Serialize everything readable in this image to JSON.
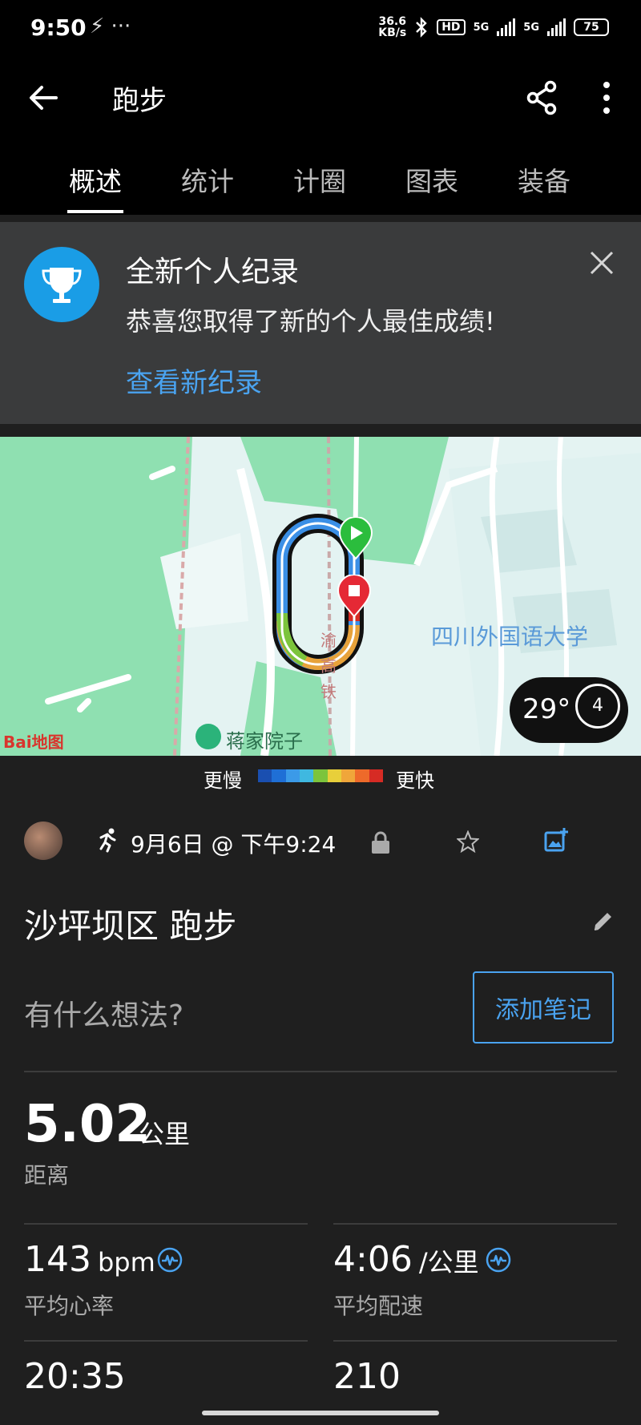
{
  "status_bar": {
    "time": "9:50",
    "misc": "⚡ ···",
    "net_speed_top": "36.6",
    "net_speed_bottom": "KB/s",
    "hd_label": "HD",
    "sig1_label": "5G",
    "sig2_label": "5G",
    "battery": "75"
  },
  "app_bar": {
    "title": "跑步",
    "back_icon": "arrow-left-icon",
    "share_icon": "share-icon",
    "more_icon": "more-vertical-icon"
  },
  "tabs": [
    {
      "label": "概述",
      "active": true
    },
    {
      "label": "统计",
      "active": false
    },
    {
      "label": "计圈",
      "active": false
    },
    {
      "label": "图表",
      "active": false
    },
    {
      "label": "装备",
      "active": false
    }
  ],
  "record_banner": {
    "title": "全新个人纪录",
    "subtitle": "恭喜您取得了新的个人最佳成绩!",
    "link": "查看新纪录",
    "icon": "trophy-icon"
  },
  "map": {
    "university_label": "四川外国语大学",
    "rail_label_chars": [
      "渝",
      "高",
      "铁"
    ],
    "poi_label": "蒋家院子",
    "provider": "Bai地图",
    "temperature": "29°",
    "wind_level": "4"
  },
  "pace_legend": {
    "slow": "更慢",
    "fast": "更快",
    "colors": [
      "#1a4fb0",
      "#1f6fd6",
      "#3b9ae8",
      "#3fb8e0",
      "#7cc43c",
      "#e8cf3a",
      "#f0a63a",
      "#ee6a2a",
      "#d62b24"
    ]
  },
  "activity": {
    "date": "9月6日 @ 下午9:24",
    "title": "沙坪坝区 跑步",
    "thought_placeholder": "有什么想法?",
    "add_note": "添加笔记"
  },
  "stats": {
    "distance_value": "5.02",
    "distance_unit": "公里",
    "distance_label": "距离",
    "hr_value": "143",
    "hr_unit": "bpm",
    "hr_label": "平均心率",
    "pace_value": "4:06",
    "pace_unit": "/公里",
    "pace_label": "平均配速",
    "time_value": "20:35",
    "cadence_value": "210"
  }
}
